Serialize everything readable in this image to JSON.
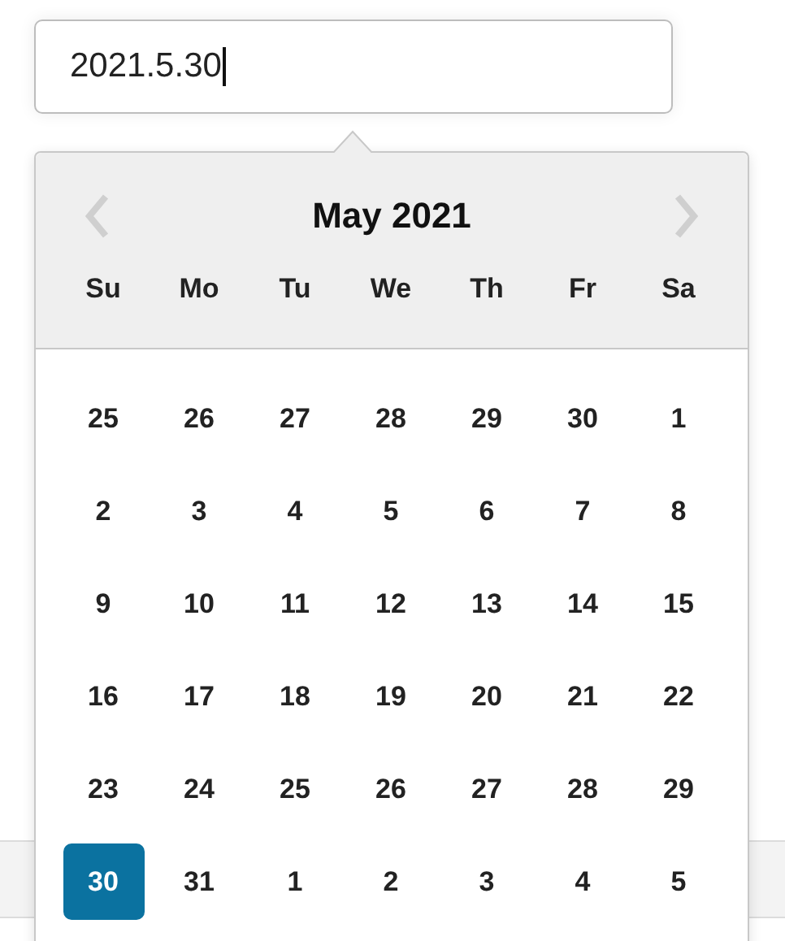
{
  "date_field": {
    "value": "2021.5.30"
  },
  "calendar": {
    "title": "May 2021",
    "weekdays": [
      "Su",
      "Mo",
      "Tu",
      "We",
      "Th",
      "Fr",
      "Sa"
    ],
    "weeks": [
      [
        {
          "label": "25",
          "selected": false
        },
        {
          "label": "26",
          "selected": false
        },
        {
          "label": "27",
          "selected": false
        },
        {
          "label": "28",
          "selected": false
        },
        {
          "label": "29",
          "selected": false
        },
        {
          "label": "30",
          "selected": false
        },
        {
          "label": "1",
          "selected": false
        }
      ],
      [
        {
          "label": "2",
          "selected": false
        },
        {
          "label": "3",
          "selected": false
        },
        {
          "label": "4",
          "selected": false
        },
        {
          "label": "5",
          "selected": false
        },
        {
          "label": "6",
          "selected": false
        },
        {
          "label": "7",
          "selected": false
        },
        {
          "label": "8",
          "selected": false
        }
      ],
      [
        {
          "label": "9",
          "selected": false
        },
        {
          "label": "10",
          "selected": false
        },
        {
          "label": "11",
          "selected": false
        },
        {
          "label": "12",
          "selected": false
        },
        {
          "label": "13",
          "selected": false
        },
        {
          "label": "14",
          "selected": false
        },
        {
          "label": "15",
          "selected": false
        }
      ],
      [
        {
          "label": "16",
          "selected": false
        },
        {
          "label": "17",
          "selected": false
        },
        {
          "label": "18",
          "selected": false
        },
        {
          "label": "19",
          "selected": false
        },
        {
          "label": "20",
          "selected": false
        },
        {
          "label": "21",
          "selected": false
        },
        {
          "label": "22",
          "selected": false
        }
      ],
      [
        {
          "label": "23",
          "selected": false
        },
        {
          "label": "24",
          "selected": false
        },
        {
          "label": "25",
          "selected": false
        },
        {
          "label": "26",
          "selected": false
        },
        {
          "label": "27",
          "selected": false
        },
        {
          "label": "28",
          "selected": false
        },
        {
          "label": "29",
          "selected": false
        }
      ],
      [
        {
          "label": "30",
          "selected": true
        },
        {
          "label": "31",
          "selected": false
        },
        {
          "label": "1",
          "selected": false
        },
        {
          "label": "2",
          "selected": false
        },
        {
          "label": "3",
          "selected": false
        },
        {
          "label": "4",
          "selected": false
        },
        {
          "label": "5",
          "selected": false
        }
      ]
    ]
  }
}
